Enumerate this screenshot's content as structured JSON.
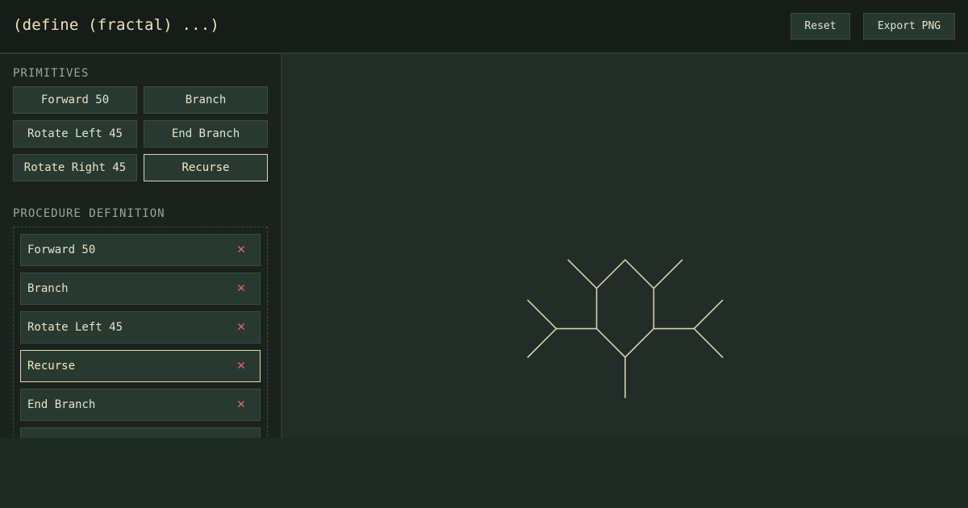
{
  "app": {
    "title": "(define (fractal) ...)"
  },
  "header": {
    "reset_label": "Reset",
    "export_label": "Export PNG"
  },
  "primitives": {
    "title": "PRIMITIVES",
    "buttons": [
      {
        "label": "Forward 50"
      },
      {
        "label": "Branch"
      },
      {
        "label": "Rotate Left 45"
      },
      {
        "label": "End Branch"
      },
      {
        "label": "Rotate Right 45"
      },
      {
        "label": "Recurse",
        "active": true
      }
    ]
  },
  "procedure": {
    "title": "PROCEDURE DEFINITION",
    "remove_symbol": "✕",
    "steps": [
      {
        "label": "Forward 50"
      },
      {
        "label": "Branch"
      },
      {
        "label": "Rotate Left 45"
      },
      {
        "label": "Recurse",
        "active": true
      },
      {
        "label": "End Branch"
      }
    ]
  },
  "canvas": {
    "stroke_color": "#d8d0aa",
    "background": "#222d27"
  },
  "colors": {
    "accent": "#e2d9a4",
    "danger": "#e06a6a",
    "panel": "#283a2f"
  }
}
